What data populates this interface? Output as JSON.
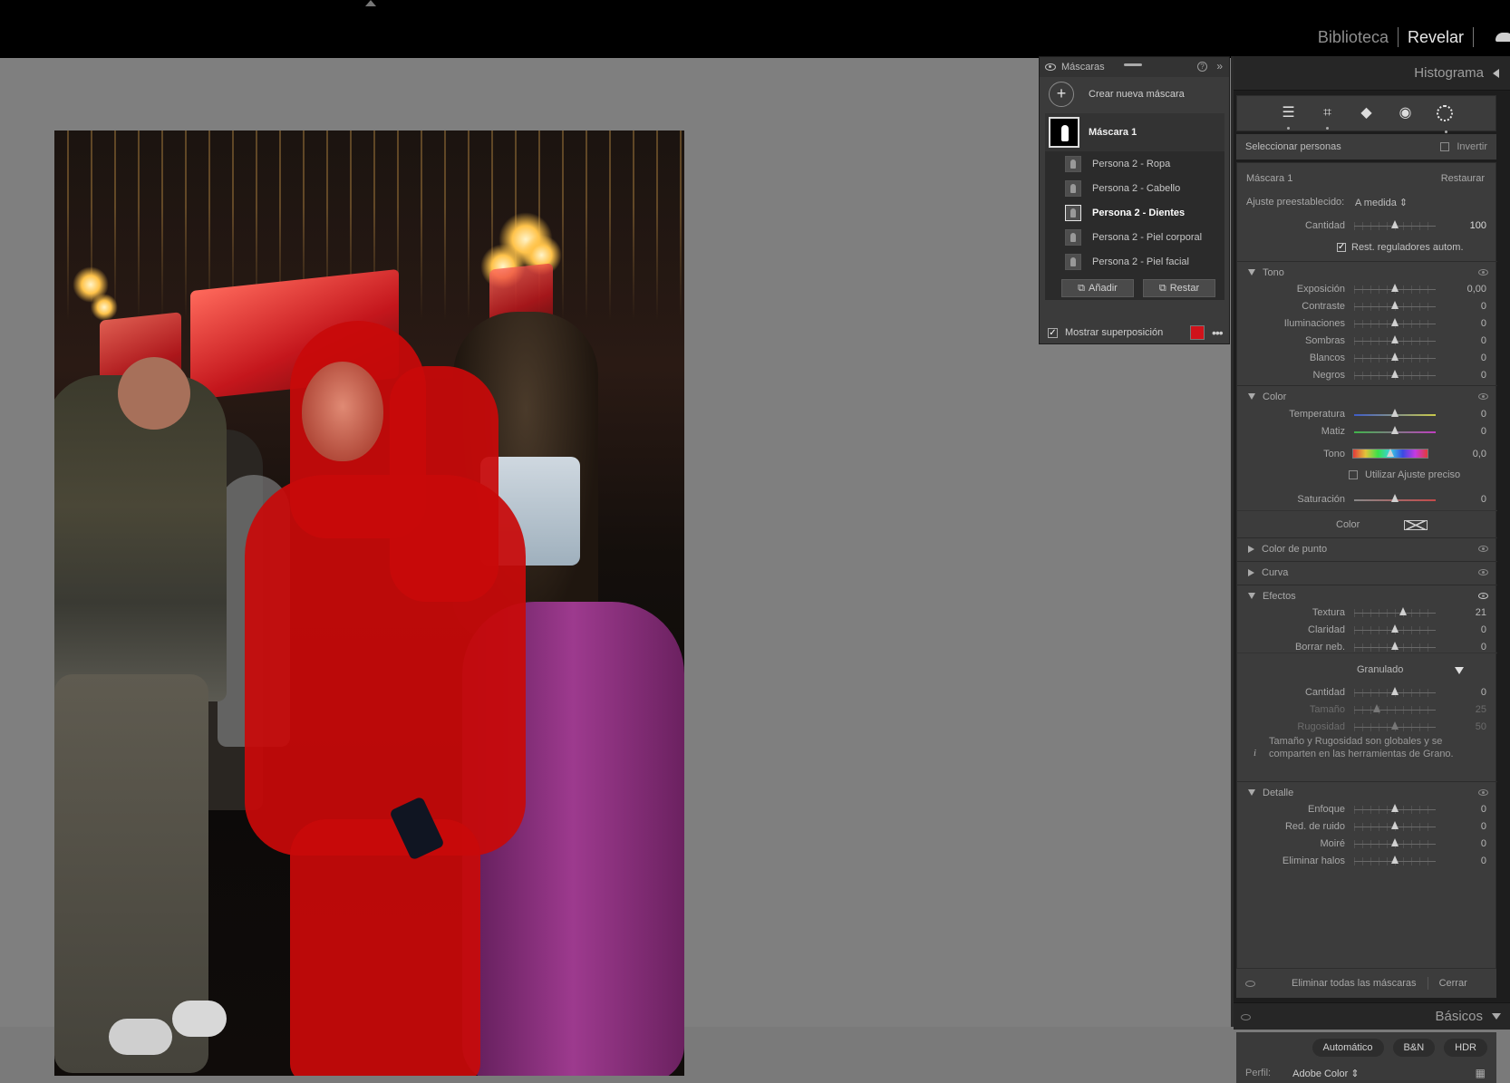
{
  "topbar": {
    "modules": [
      "Biblioteca",
      "Revelar"
    ],
    "active_module": "Revelar",
    "cloud_icon": "cloud-icon"
  },
  "masks_panel": {
    "title": "Máscaras",
    "create_label": "Crear nueva máscara",
    "mask_name": "Máscara 1",
    "submasks": [
      {
        "label": "Persona 2 - Ropa",
        "selected": false
      },
      {
        "label": "Persona 2 - Cabello",
        "selected": false
      },
      {
        "label": "Persona 2 - Dientes",
        "selected": true
      },
      {
        "label": "Persona 2 - Piel corporal",
        "selected": false
      },
      {
        "label": "Persona 2 - Piel facial",
        "selected": false
      }
    ],
    "add_label": "Añadir",
    "subtract_label": "Restar",
    "overlay_label": "Mostrar superposición",
    "overlay_checked": true,
    "overlay_color": "#d0121a"
  },
  "right_panel": {
    "histogram_title": "Histograma",
    "tools": [
      "sliders-icon",
      "crop-icon",
      "eraser-icon",
      "redeye-icon",
      "mask-icon"
    ],
    "select_people_label": "Seleccionar personas",
    "invert_label": "Invertir",
    "mask_label": "Máscara 1",
    "reset_label": "Restaurar",
    "preset_label": "Ajuste preestablecido:",
    "preset_value": "A medida",
    "amount_label": "Cantidad",
    "amount_value": "100",
    "auto_reset_label": "Rest. reguladores autom.",
    "sections": {
      "tone": "Tono",
      "color": "Color",
      "point_color": "Color de punto",
      "curve": "Curva",
      "effects": "Efectos",
      "detail": "Detalle"
    },
    "tone_rows": [
      {
        "label": "Exposición",
        "value": "0,00",
        "pos": 0.5
      },
      {
        "label": "Contraste",
        "value": "0",
        "pos": 0.5
      },
      {
        "label": "Iluminaciones",
        "value": "0",
        "pos": 0.5
      },
      {
        "label": "Sombras",
        "value": "0",
        "pos": 0.5
      },
      {
        "label": "Blancos",
        "value": "0",
        "pos": 0.5
      },
      {
        "label": "Negros",
        "value": "0",
        "pos": 0.5
      }
    ],
    "color_rows": {
      "temp_label": "Temperatura",
      "temp_value": "0",
      "tint_label": "Matiz",
      "tint_value": "0",
      "hue_label": "Tono",
      "hue_value": "0,0",
      "fine_adjust_label": "Utilizar Ajuste preciso",
      "sat_label": "Saturación",
      "sat_value": "0",
      "color_label": "Color"
    },
    "effects_rows": [
      {
        "label": "Textura",
        "value": "21",
        "pos": 0.6
      },
      {
        "label": "Claridad",
        "value": "0",
        "pos": 0.5
      },
      {
        "label": "Borrar neb.",
        "value": "0",
        "pos": 0.5
      }
    ],
    "grain": {
      "title": "Granulado",
      "rows": [
        {
          "label": "Cantidad",
          "value": "0",
          "pos": 0.5,
          "dim": false
        },
        {
          "label": "Tamaño",
          "value": "25",
          "pos": 0.28,
          "dim": true
        },
        {
          "label": "Rugosidad",
          "value": "50",
          "pos": 0.5,
          "dim": true
        }
      ],
      "note_line1": "Tamaño y Rugosidad son globales y se",
      "note_line2": "comparten en las herramientas de Grano."
    },
    "detail_rows": [
      {
        "label": "Enfoque",
        "value": "0",
        "pos": 0.5
      },
      {
        "label": "Red. de ruido",
        "value": "0",
        "pos": 0.5
      },
      {
        "label": "Moiré",
        "value": "0",
        "pos": 0.5
      },
      {
        "label": "Eliminar halos",
        "value": "0",
        "pos": 0.5
      }
    ],
    "delete_all_label": "Eliminar todas las máscaras",
    "close_label": "Cerrar",
    "basics_title": "Básicos",
    "auto_label": "Automático",
    "bw_label": "B&N",
    "hdr_label": "HDR",
    "profile_label": "Perfil:",
    "profile_value": "Adobe Color"
  }
}
